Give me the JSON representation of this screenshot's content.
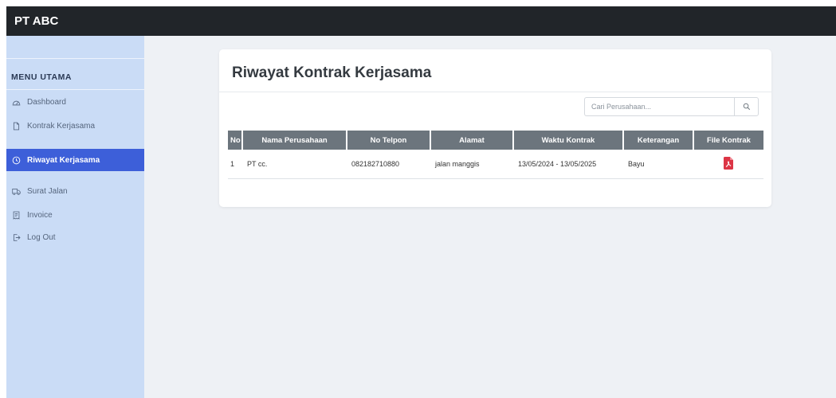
{
  "app": {
    "title": "PT ABC"
  },
  "sidebar": {
    "heading": "MENU UTAMA",
    "items": [
      {
        "label": "Dashboard",
        "icon": "dashboard-icon"
      },
      {
        "label": "Kontrak Kerjasama",
        "icon": "document-icon"
      },
      {
        "label": "Riwayat Kerjasama",
        "icon": "history-icon",
        "active": true
      },
      {
        "label": "Surat Jalan",
        "icon": "truck-icon"
      },
      {
        "label": "Invoice",
        "icon": "receipt-icon"
      },
      {
        "label": "Log Out",
        "icon": "logout-icon"
      }
    ]
  },
  "main": {
    "title": "Riwayat Kontrak Kerjasama",
    "search": {
      "placeholder": "Cari Perusahaan...",
      "button_icon": "search-icon"
    },
    "table": {
      "columns": [
        "No",
        "Nama Perusahaan",
        "No Telpon",
        "Alamat",
        "Waktu Kontrak",
        "Keterangan",
        "File Kontrak"
      ],
      "rows": [
        {
          "no": "1",
          "nama": "PT cc.",
          "telpon": "082182710880",
          "alamat": "jalan manggis",
          "waktu": "13/05/2024 - 13/05/2025",
          "keterangan": "Bayu",
          "file_icon": "pdf-file-icon"
        }
      ]
    }
  },
  "colors": {
    "topbar": "#212529",
    "sidebar": "#cadcf6",
    "active": "#3d5fd9",
    "thead": "#6c757d",
    "content": "#eef1f5",
    "pdf": "#dc3545"
  }
}
